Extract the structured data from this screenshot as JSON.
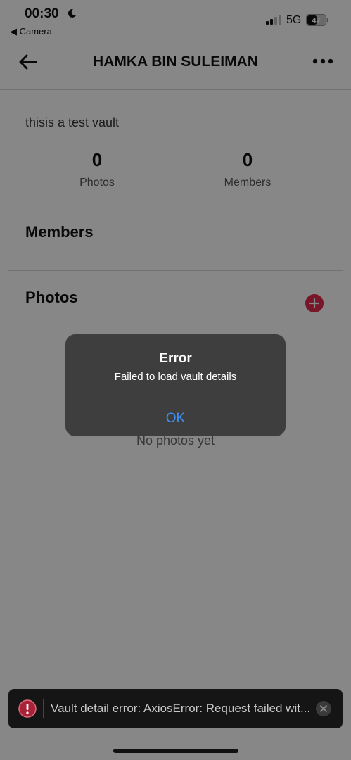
{
  "status_bar": {
    "time": "00:30",
    "back_app": "◀ Camera",
    "network": "5G",
    "battery": "47"
  },
  "header": {
    "title": "HAMKA BIN SULEIMAN"
  },
  "vault": {
    "description": "thisis a test vault",
    "stats": [
      {
        "value": "0",
        "label": "Photos"
      },
      {
        "value": "0",
        "label": "Members"
      }
    ]
  },
  "sections": {
    "members_title": "Members",
    "photos_title": "Photos",
    "empty_photos": "No photos yet"
  },
  "alert": {
    "title": "Error",
    "message": "Failed to load vault details",
    "ok_label": "OK"
  },
  "toast": {
    "text": "Vault detail error: AxiosError: Request failed wit..."
  },
  "colors": {
    "accent": "#e0294f",
    "alert_button": "#3d8ef5",
    "toast_bg": "#151515"
  }
}
